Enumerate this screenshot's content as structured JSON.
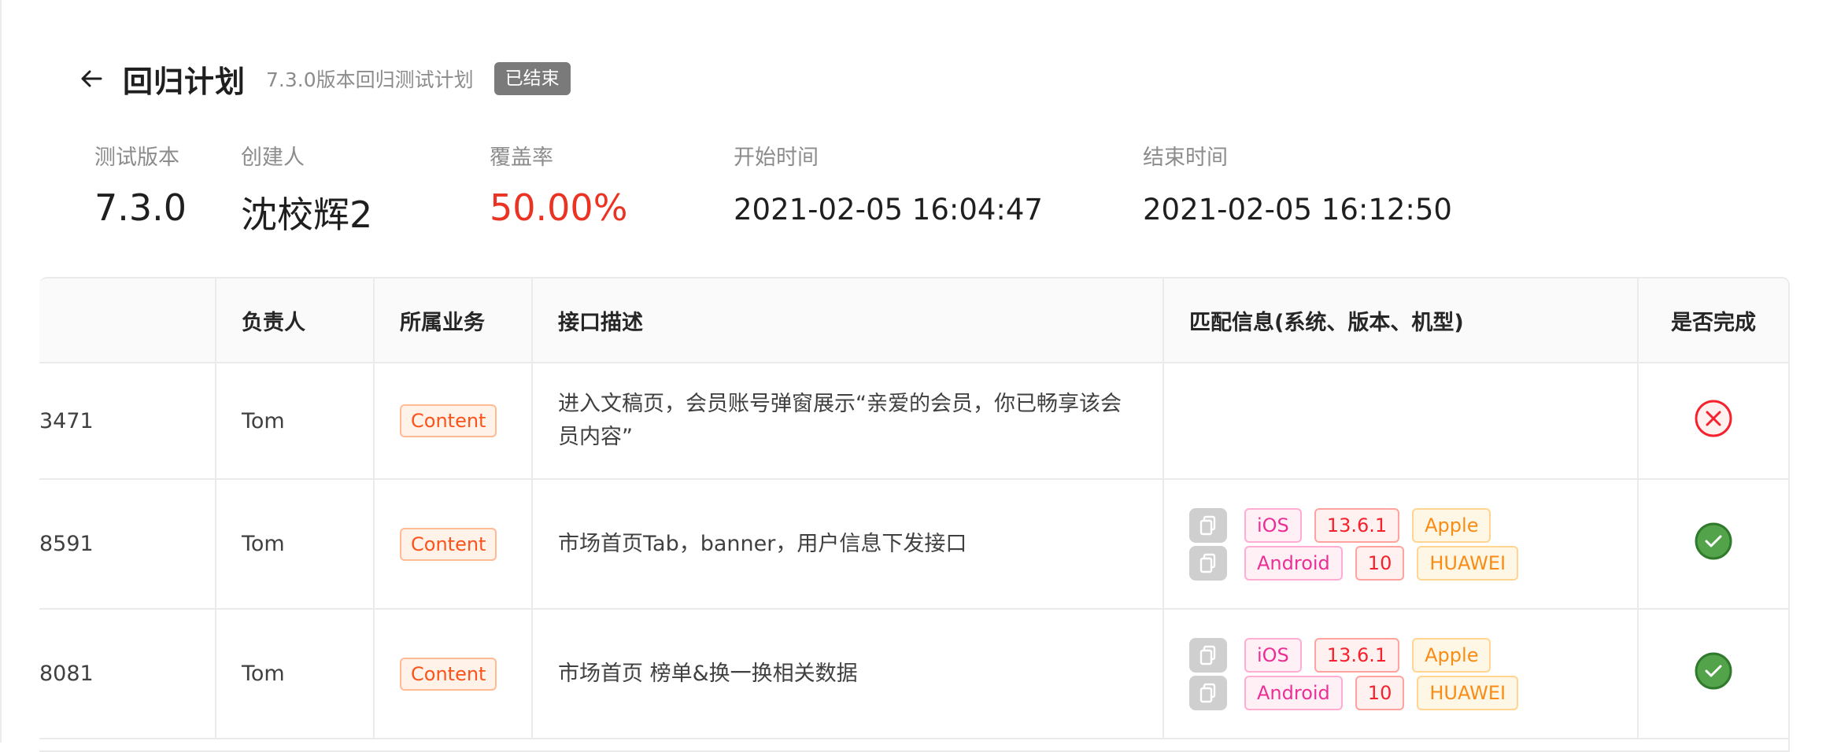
{
  "header": {
    "title": "回归计划",
    "subtitle": "7.3.0版本回归测试计划",
    "status": "已结束"
  },
  "stats": [
    {
      "label": "测试版本",
      "value": "7.3.0"
    },
    {
      "label": "创建人",
      "value": "沈校辉2"
    },
    {
      "label": "覆盖率",
      "value": "50.00%"
    },
    {
      "label": "开始时间",
      "value": "2021-02-05 16:04:47"
    },
    {
      "label": "结束时间",
      "value": "2021-02-05 16:12:50"
    }
  ],
  "table": {
    "columns": [
      "",
      "负责人",
      "所属业务",
      "接口描述",
      "匹配信息(系统、版本、机型)",
      "是否完成"
    ],
    "rows": [
      {
        "id": "3471",
        "owner": "Tom",
        "business": "Content",
        "description": "进入文稿页，会员账号弹窗展示“亲爱的会员，你已畅享该会员内容”",
        "match": [],
        "done": false
      },
      {
        "id": "8591",
        "owner": "Tom",
        "business": "Content",
        "description": "市场首页Tab，banner，用户信息下发接口",
        "match": [
          {
            "os": "iOS",
            "version": "13.6.1",
            "brand": "Apple"
          },
          {
            "os": "Android",
            "version": "10",
            "brand": "HUAWEI"
          }
        ],
        "done": true
      },
      {
        "id": "8081",
        "owner": "Tom",
        "business": "Content",
        "description": "市场首页 榜单&换一换相关数据",
        "match": [
          {
            "os": "iOS",
            "version": "13.6.1",
            "brand": "Apple"
          },
          {
            "os": "Android",
            "version": "10",
            "brand": "HUAWEI"
          }
        ],
        "done": true
      }
    ]
  },
  "colors": {
    "accent_red": "#ea3323",
    "done_green": "#52c41a",
    "not_done_red": "#f5222d"
  }
}
